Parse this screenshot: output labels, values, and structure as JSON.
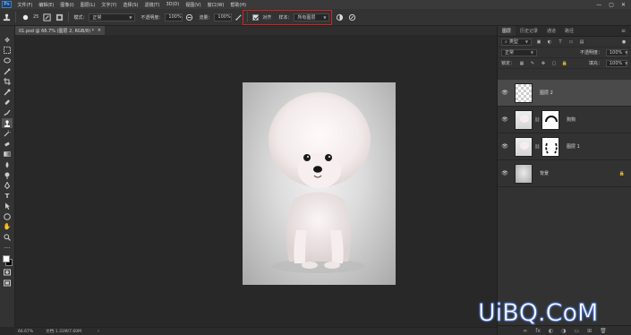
{
  "menubar": {
    "logo": "Ps",
    "items": [
      "文件(F)",
      "编辑(E)",
      "图像(I)",
      "图层(L)",
      "文字(Y)",
      "选择(S)",
      "滤镜(T)",
      "3D(D)",
      "视图(V)",
      "窗口(W)",
      "帮助(H)"
    ],
    "window_buttons": [
      "—",
      "▢",
      "✕"
    ]
  },
  "optionsbar": {
    "brush_size": "25",
    "mode_label": "模式：",
    "mode_value": "正常",
    "opacity_label": "不透明度：",
    "opacity_value": "100%",
    "flow_label": "流量：",
    "flow_value": "100%",
    "aligned_label": "对齐",
    "sample_label": "样本：",
    "sample_value": "所有图层"
  },
  "document": {
    "tab_title": "01.psd @ 66.7% (图层 2, RGB/8) *",
    "close": "×"
  },
  "statusbar": {
    "zoom": "66.67%",
    "doc_size": "文档:1.31M/7.60M",
    "arrow": "›"
  },
  "panel": {
    "tabs": [
      "图层",
      "历史记录",
      "通道",
      "路径"
    ],
    "kind_value": "类型",
    "blend_value": "正常",
    "opacity_label": "不透明度：",
    "opacity_value": "100%",
    "lock_label": "锁定：",
    "fill_label": "填充：",
    "fill_value": "100%",
    "layers": [
      {
        "name": "图层 2"
      },
      {
        "name": "狗狗"
      },
      {
        "name": "图层 1"
      },
      {
        "name": "背景"
      }
    ],
    "bottom_icons": [
      "∞",
      "fx",
      "◐",
      "◑",
      "▭",
      "⊞",
      "🗑"
    ]
  },
  "watermark": "UiBQ.CoM",
  "colors": {
    "highlight": "#d32222",
    "arrow": "#e03030",
    "accent": "#3c6be0"
  }
}
